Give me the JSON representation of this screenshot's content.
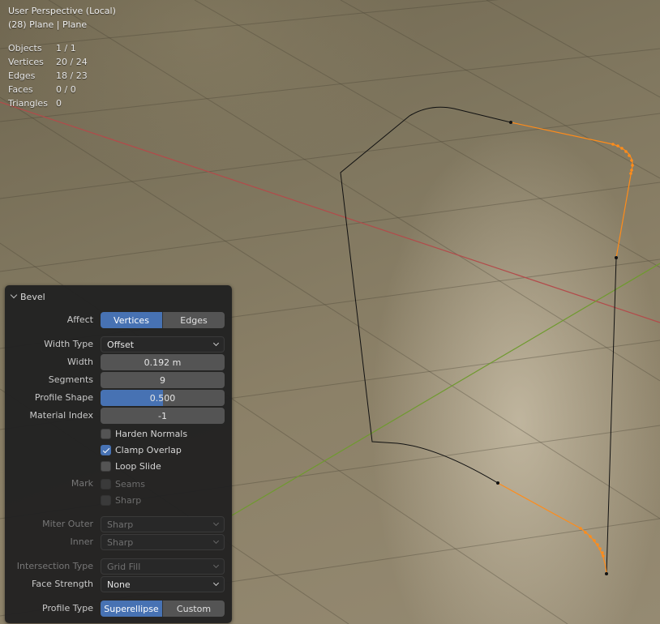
{
  "viewport": {
    "title": "User Perspective (Local)",
    "subtitle": "(28) Plane | Plane",
    "stats": [
      {
        "label": "Objects",
        "value": "1 / 1"
      },
      {
        "label": "Vertices",
        "value": "20 / 24"
      },
      {
        "label": "Edges",
        "value": "18 / 23"
      },
      {
        "label": "Faces",
        "value": "0 / 0"
      },
      {
        "label": "Triangles",
        "value": "0"
      }
    ]
  },
  "panel": {
    "title": "Bevel",
    "affect": {
      "label": "Affect",
      "options": [
        "Vertices",
        "Edges"
      ],
      "selected": "Vertices"
    },
    "width_type": {
      "label": "Width Type",
      "value": "Offset"
    },
    "width": {
      "label": "Width",
      "value": "0.192 m"
    },
    "segments": {
      "label": "Segments",
      "value": "9"
    },
    "profile_shape": {
      "label": "Profile Shape",
      "value": "0.500",
      "fill": 0.5
    },
    "material_index": {
      "label": "Material Index",
      "value": "-1"
    },
    "harden_normals": {
      "label": "Harden Normals",
      "checked": false
    },
    "clamp_overlap": {
      "label": "Clamp Overlap",
      "checked": true
    },
    "loop_slide": {
      "label": "Loop Slide",
      "checked": false
    },
    "mark": {
      "label": "Mark",
      "seams_label": "Seams",
      "sharp_label": "Sharp"
    },
    "miter_outer": {
      "label": "Miter Outer",
      "value": "Sharp"
    },
    "inner": {
      "label": "Inner",
      "value": "Sharp"
    },
    "intersection_type": {
      "label": "Intersection Type",
      "value": "Grid Fill"
    },
    "face_strength": {
      "label": "Face Strength",
      "value": "None"
    },
    "profile_type": {
      "label": "Profile Type",
      "options": [
        "Superellipse",
        "Custom"
      ],
      "selected": "Superellipse"
    }
  },
  "colors": {
    "accent": "#4772b3",
    "selection": "#ff8c1a",
    "x_axis": "#b34a4a",
    "y_axis": "#6f9a2e"
  }
}
